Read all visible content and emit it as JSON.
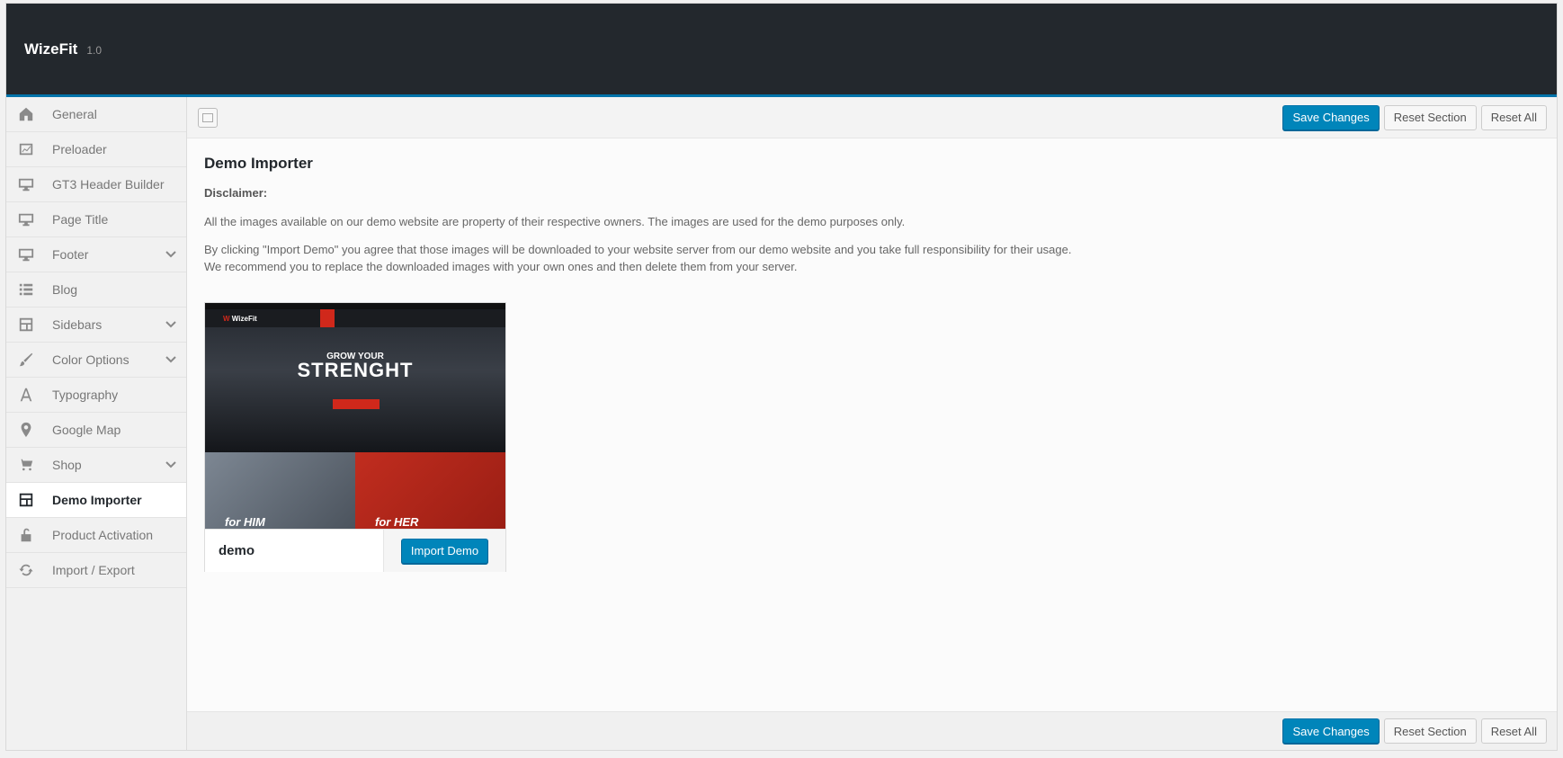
{
  "header": {
    "brand": "WizeFit",
    "version": "1.0"
  },
  "sidebar": {
    "items": [
      {
        "label": "General",
        "icon": "home-icon"
      },
      {
        "label": "Preloader",
        "icon": "chart-icon"
      },
      {
        "label": "GT3 Header Builder",
        "icon": "desktop-icon"
      },
      {
        "label": "Page Title",
        "icon": "desktop-icon"
      },
      {
        "label": "Footer",
        "icon": "desktop-icon",
        "expandable": true
      },
      {
        "label": "Blog",
        "icon": "list-icon"
      },
      {
        "label": "Sidebars",
        "icon": "layout-icon",
        "expandable": true
      },
      {
        "label": "Color Options",
        "icon": "brush-icon",
        "expandable": true
      },
      {
        "label": "Typography",
        "icon": "typography-icon"
      },
      {
        "label": "Google Map",
        "icon": "location-pin-icon"
      },
      {
        "label": "Shop",
        "icon": "cart-icon",
        "expandable": true
      },
      {
        "label": "Demo Importer",
        "icon": "layout-icon",
        "active": true
      },
      {
        "label": "Product Activation",
        "icon": "unlock-icon"
      },
      {
        "label": "Import / Export",
        "icon": "refresh-icon"
      }
    ]
  },
  "toolbar": {
    "save_label": "Save Changes",
    "reset_section_label": "Reset Section",
    "reset_all_label": "Reset All"
  },
  "content": {
    "title": "Demo Importer",
    "disclaimer_label": "Disclaimer:",
    "paragraph1": "All the images available on our demo website are property of their respective owners. The images are used for the demo purposes only.",
    "paragraph2_line1": "By clicking \"Import Demo\" you agree that those images will be downloaded to your website server from our demo website and you take full responsibility for their usage.",
    "paragraph2_line2": "We recommend you to replace the downloaded images with your own ones and then delete them from your server."
  },
  "demo": {
    "name": "demo",
    "import_label": "Import Demo",
    "preview": {
      "logo": "WizeFit",
      "headline_small": "GROW YOUR",
      "headline_large": "STRENGHT",
      "him_label": "for HIM",
      "her_label": "for HER"
    }
  },
  "colors": {
    "accent": "#0085ba",
    "header_bg": "#23282d",
    "preview_red": "#d0281b"
  }
}
